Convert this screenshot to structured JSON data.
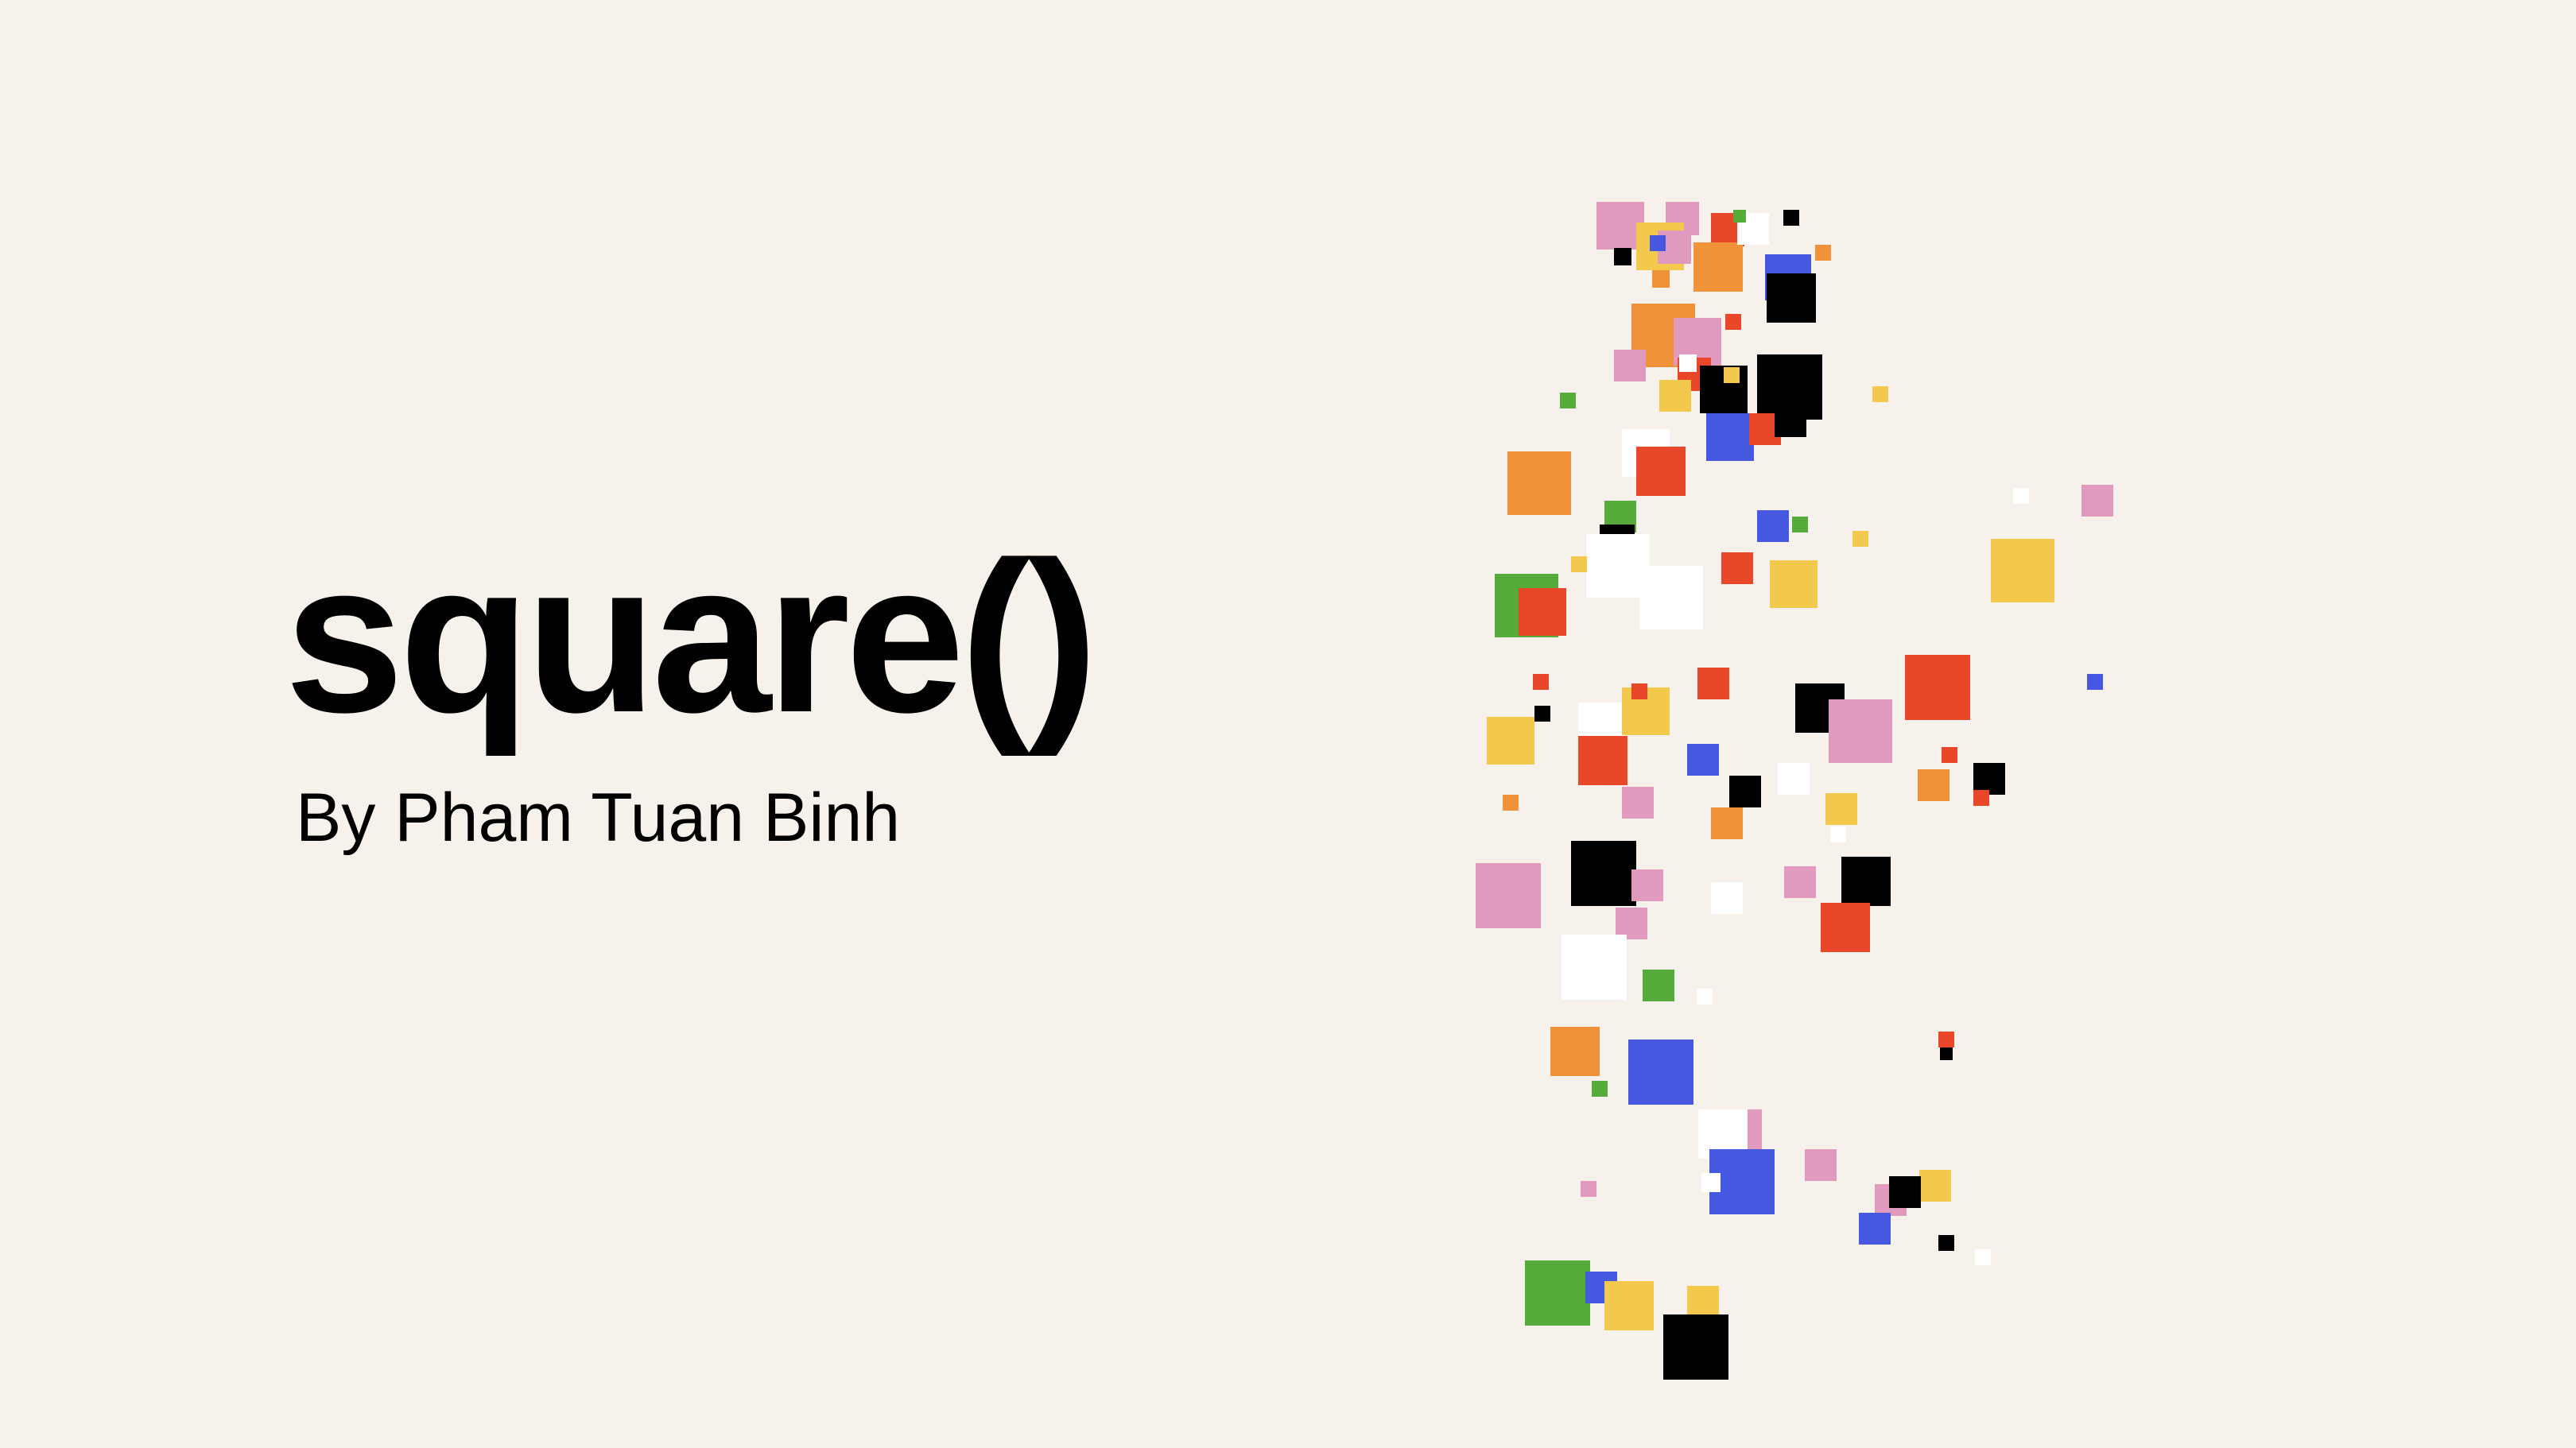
{
  "slide": {
    "title": "square()",
    "byline": "By Pham Tuan Binh"
  },
  "colors": {
    "background": "#f6f2eb",
    "text": "#000000",
    "palette": {
      "pink": "#e09abd",
      "yellow": "#f2c94c",
      "orange": "#f0923a",
      "red": "#e8472a",
      "blue": "#4658e0",
      "green": "#56ab3a",
      "black": "#000000",
      "white": "#ffffff"
    }
  },
  "graphic": {
    "icon": "scattered-squares-art"
  }
}
